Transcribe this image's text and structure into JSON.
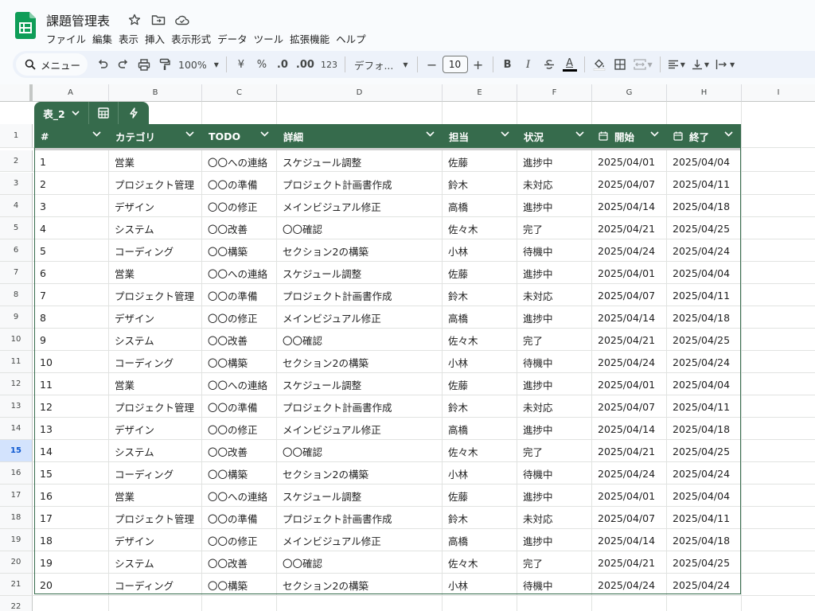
{
  "doc": {
    "title": "課題管理表",
    "menu": [
      "ファイル",
      "編集",
      "表示",
      "挿入",
      "表示形式",
      "データ",
      "ツール",
      "拡張機能",
      "ヘルプ"
    ]
  },
  "toolbar": {
    "search_label": "メニュー",
    "zoom": "100%",
    "currency": "¥",
    "percent": "%",
    "dec_decrease": ".0",
    "dec_increase": ".00",
    "number_format": "123",
    "font": "デフォ...",
    "font_size": "10",
    "minus": "−",
    "plus": "+",
    "bold": "B",
    "italic": "I",
    "text_color": "A"
  },
  "columns": [
    "A",
    "B",
    "C",
    "D",
    "E",
    "F",
    "G",
    "H",
    "I"
  ],
  "selected_row": "15",
  "table": {
    "name": "表_2",
    "headers": [
      "#",
      "カテゴリ",
      "TODO",
      "詳細",
      "担当",
      "状況",
      "開始",
      "終了"
    ],
    "rows": [
      [
        "1",
        "営業",
        "〇〇への連絡",
        "スケジュール調整",
        "佐藤",
        "進捗中",
        "2025/04/01",
        "2025/04/04"
      ],
      [
        "2",
        "プロジェクト管理",
        "〇〇の準備",
        "プロジェクト計画書作成",
        "鈴木",
        "未対応",
        "2025/04/07",
        "2025/04/11"
      ],
      [
        "3",
        "デザイン",
        "〇〇の修正",
        "メインビジュアル修正",
        "高橋",
        "進捗中",
        "2025/04/14",
        "2025/04/18"
      ],
      [
        "4",
        "システム",
        "〇〇改善",
        "〇〇確認",
        "佐々木",
        "完了",
        "2025/04/21",
        "2025/04/25"
      ],
      [
        "5",
        "コーディング",
        "〇〇構築",
        "セクション2の構築",
        "小林",
        "待機中",
        "2025/04/24",
        "2025/04/24"
      ],
      [
        "6",
        "営業",
        "〇〇への連絡",
        "スケジュール調整",
        "佐藤",
        "進捗中",
        "2025/04/01",
        "2025/04/04"
      ],
      [
        "7",
        "プロジェクト管理",
        "〇〇の準備",
        "プロジェクト計画書作成",
        "鈴木",
        "未対応",
        "2025/04/07",
        "2025/04/11"
      ],
      [
        "8",
        "デザイン",
        "〇〇の修正",
        "メインビジュアル修正",
        "高橋",
        "進捗中",
        "2025/04/14",
        "2025/04/18"
      ],
      [
        "9",
        "システム",
        "〇〇改善",
        "〇〇確認",
        "佐々木",
        "完了",
        "2025/04/21",
        "2025/04/25"
      ],
      [
        "10",
        "コーディング",
        "〇〇構築",
        "セクション2の構築",
        "小林",
        "待機中",
        "2025/04/24",
        "2025/04/24"
      ],
      [
        "11",
        "営業",
        "〇〇への連絡",
        "スケジュール調整",
        "佐藤",
        "進捗中",
        "2025/04/01",
        "2025/04/04"
      ],
      [
        "12",
        "プロジェクト管理",
        "〇〇の準備",
        "プロジェクト計画書作成",
        "鈴木",
        "未対応",
        "2025/04/07",
        "2025/04/11"
      ],
      [
        "13",
        "デザイン",
        "〇〇の修正",
        "メインビジュアル修正",
        "高橋",
        "進捗中",
        "2025/04/14",
        "2025/04/18"
      ],
      [
        "14",
        "システム",
        "〇〇改善",
        "〇〇確認",
        "佐々木",
        "完了",
        "2025/04/21",
        "2025/04/25"
      ],
      [
        "15",
        "コーディング",
        "〇〇構築",
        "セクション2の構築",
        "小林",
        "待機中",
        "2025/04/24",
        "2025/04/24"
      ],
      [
        "16",
        "営業",
        "〇〇への連絡",
        "スケジュール調整",
        "佐藤",
        "進捗中",
        "2025/04/01",
        "2025/04/04"
      ],
      [
        "17",
        "プロジェクト管理",
        "〇〇の準備",
        "プロジェクト計画書作成",
        "鈴木",
        "未対応",
        "2025/04/07",
        "2025/04/11"
      ],
      [
        "18",
        "デザイン",
        "〇〇の修正",
        "メインビジュアル修正",
        "高橋",
        "進捗中",
        "2025/04/14",
        "2025/04/18"
      ],
      [
        "19",
        "システム",
        "〇〇改善",
        "〇〇確認",
        "佐々木",
        "完了",
        "2025/04/21",
        "2025/04/25"
      ],
      [
        "20",
        "コーディング",
        "〇〇構築",
        "セクション2の構築",
        "小林",
        "待機中",
        "2025/04/24",
        "2025/04/24"
      ]
    ]
  },
  "row_numbers": [
    "1",
    "2",
    "3",
    "4",
    "5",
    "6",
    "7",
    "8",
    "9",
    "10",
    "11",
    "12",
    "13",
    "14",
    "15",
    "16",
    "17",
    "18",
    "19",
    "20",
    "21",
    "22"
  ],
  "colors": {
    "table_header": "#366b4c",
    "logo_green": "#0f9d58",
    "selection": "#d3e3fd"
  }
}
